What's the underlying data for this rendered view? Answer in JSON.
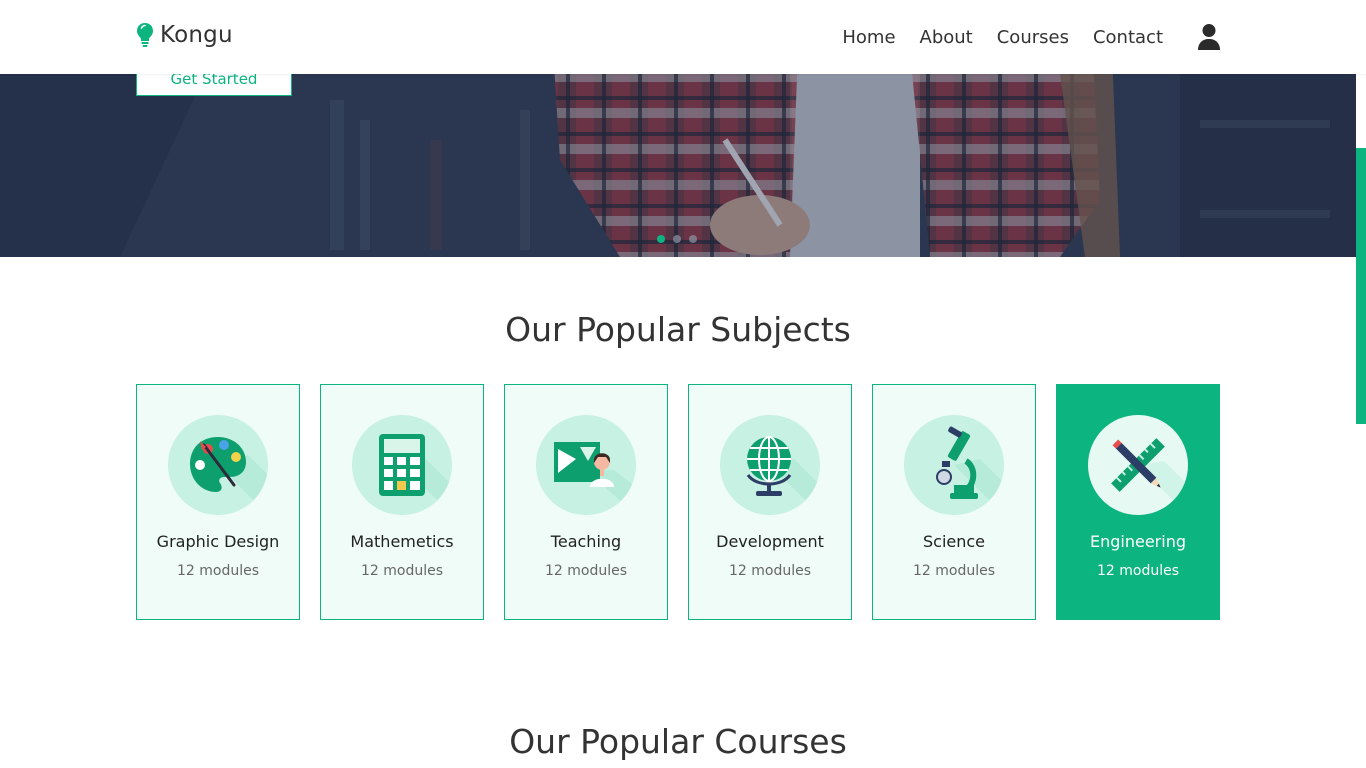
{
  "brand": {
    "name": "Kongu",
    "color": "#0cb47f"
  },
  "nav": {
    "items": [
      {
        "label": "Home"
      },
      {
        "label": "About"
      },
      {
        "label": "Courses"
      },
      {
        "label": "Contact"
      }
    ],
    "user_icon": "user-icon"
  },
  "hero": {
    "button_label": "Get Started",
    "slides": 3,
    "active_slide": 1
  },
  "subjects": {
    "title": "Our Popular Subjects",
    "items": [
      {
        "title": "Graphic Design",
        "modules": "12 modules",
        "icon": "palette-icon"
      },
      {
        "title": "Mathemetics",
        "modules": "12 modules",
        "icon": "calculator-icon"
      },
      {
        "title": "Teaching",
        "modules": "12 modules",
        "icon": "teacher-icon"
      },
      {
        "title": "Development",
        "modules": "12 modules",
        "icon": "globe-icon"
      },
      {
        "title": "Science",
        "modules": "12 modules",
        "icon": "microscope-icon"
      },
      {
        "title": "Engineering",
        "modules": "12 modules",
        "icon": "pencil-ruler-icon",
        "active": true
      }
    ]
  },
  "courses": {
    "title": "Our Popular Courses"
  },
  "colors": {
    "accent": "#0cb47f",
    "card_bg": "#effcf8",
    "icon_circle": "#c7f1e2"
  }
}
